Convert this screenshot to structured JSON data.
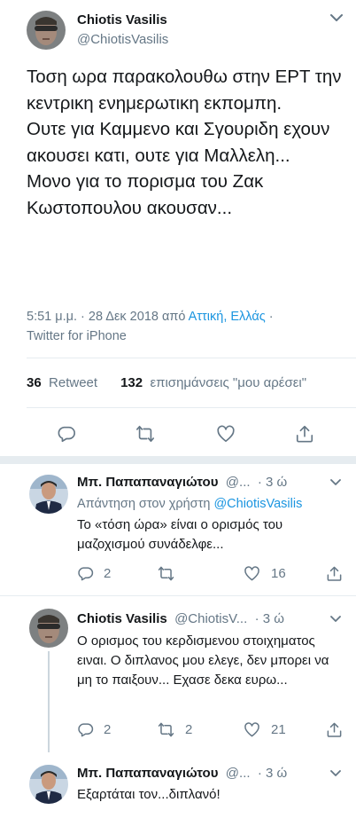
{
  "main_tweet": {
    "author_name": "Chiotis Vasilis",
    "author_handle": "@ChiotisVasilis",
    "text": "Τοση ωρα παρακολουθω στην ΕΡΤ την κεντρικη ενημερωτικη εκπομπη.\nΟυτε για Καμμενο και Σγουριδη εχουν ακουσει κατι, ουτε για Μαλλελη...\nΜονο για το πορισμα του Ζακ Κωστοπουλου ακουσαν...",
    "time_prefix": "5:51 μ.μ. · 28 Δεκ 2018 από ",
    "location": "Αττική, Ελλάς",
    "time_suffix": " ·",
    "source": "Twitter for iPhone",
    "retweets_count": "36",
    "retweets_label": "Retweet",
    "likes_count": "132",
    "likes_label": "επισημάνσεις \"μου αρέσει\""
  },
  "replies": [
    {
      "name": "Μπ. Παπαπαναγιώτου",
      "handle": "@...",
      "time": "· 3 ώ",
      "reply_prefix": "Απάντηση στον χρήστη ",
      "reply_to": "@ChiotisVasilis",
      "text": "Το «τόση ώρα» είναι ο ορισμός του μαζοχισμού συνάδελφε...",
      "replies": "2",
      "retweets": "",
      "likes": "16"
    },
    {
      "name": "Chiotis Vasilis",
      "handle": "@ChiotisV...",
      "time": "· 3 ώ",
      "text": "Ο ορισμος του κερδισμενου στοιχηματος ειναι. Ο διπλανος μου ελεγε, δεν μπορει να μη το παιξουν... Εχασε δεκα ευρω...",
      "replies": "2",
      "retweets": "2",
      "likes": "21"
    },
    {
      "name": "Μπ. Παπαπαναγιώτου",
      "handle": "@...",
      "time": "· 3 ώ",
      "text": "Εξαρτάται τον...διπλανό!"
    }
  ],
  "icons": {
    "reply": "reply-icon",
    "retweet": "retweet-icon",
    "like": "heart-icon",
    "share": "share-icon",
    "menu": "chevron-down-icon"
  },
  "colors": {
    "text": "#14171a",
    "secondary": "#657786",
    "link": "#1b95e0",
    "divider": "#e6ecf0"
  }
}
